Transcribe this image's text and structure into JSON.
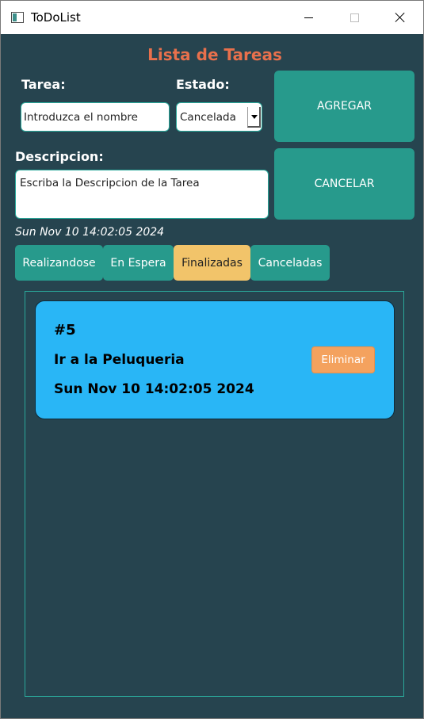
{
  "window": {
    "title": "ToDoList"
  },
  "page": {
    "title": "Lista de Tareas"
  },
  "form": {
    "task_label": "Tarea:",
    "task_placeholder": "Introduzca el nombre",
    "status_label": "Estado:",
    "status_selected": "Cancelada",
    "description_label": "Descripcion:",
    "description_placeholder": "Escriba la Descripcion de la Tarea",
    "add_button": "AGREGAR",
    "cancel_button": "CANCELAR"
  },
  "current_datetime": "Sun Nov 10 14:02:05 2024",
  "tabs": [
    {
      "label": "Realizandose",
      "active": false
    },
    {
      "label": "En Espera",
      "active": false
    },
    {
      "label": "Finalizadas",
      "active": true
    },
    {
      "label": "Canceladas",
      "active": false
    }
  ],
  "tasks": [
    {
      "id": "#5",
      "name": "Ir a la Peluqueria",
      "date": "Sun Nov 10 14:02:05 2024",
      "delete_label": "Eliminar"
    }
  ],
  "colors": {
    "background": "#26444f",
    "title": "#e8704c",
    "button": "#279a8c",
    "active_tab": "#f2c46a",
    "card": "#29b6f6",
    "delete_button": "#f4a25e"
  },
  "icons": {
    "app": "app-window-icon",
    "minimize": "minimize-icon",
    "maximize": "maximize-icon",
    "close": "close-icon",
    "dropdown": "chevron-down-icon"
  }
}
